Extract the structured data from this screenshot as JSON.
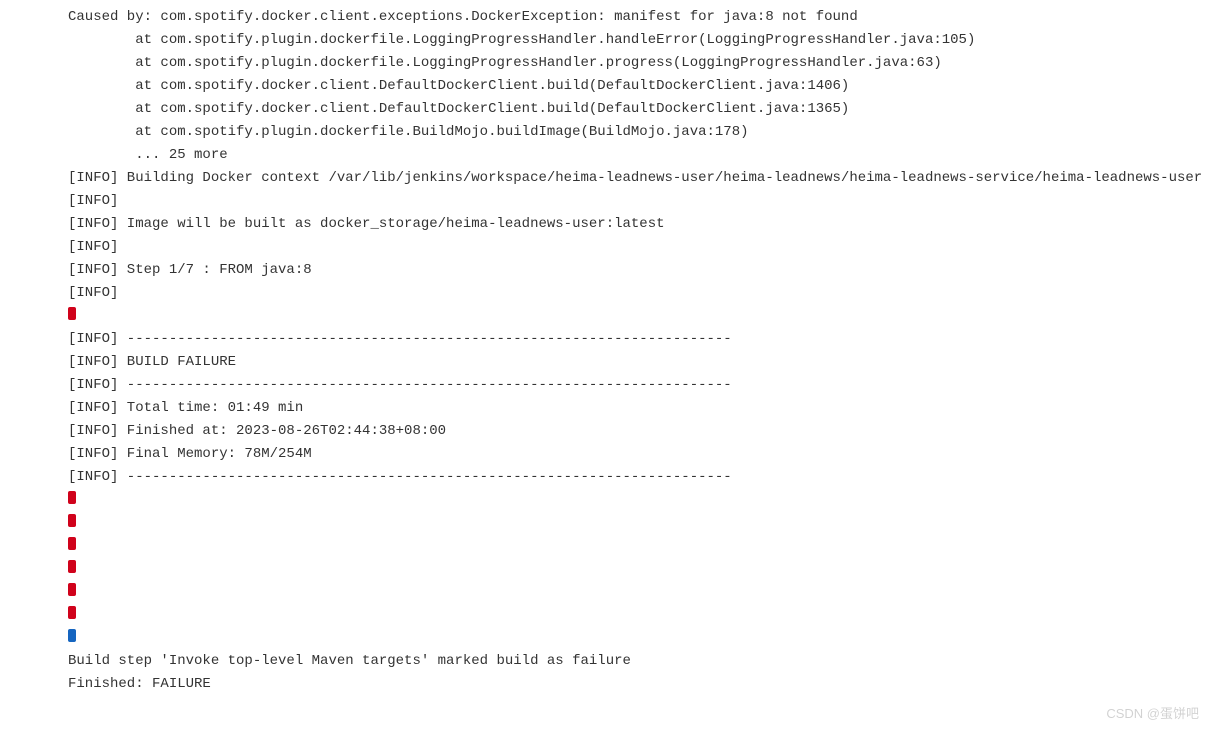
{
  "console": {
    "lines": [
      "Caused by: com.spotify.docker.client.exceptions.DockerException: manifest for java:8 not found",
      "        at com.spotify.plugin.dockerfile.LoggingProgressHandler.handleError(LoggingProgressHandler.java:105)",
      "        at com.spotify.plugin.dockerfile.LoggingProgressHandler.progress(LoggingProgressHandler.java:63)",
      "        at com.spotify.docker.client.DefaultDockerClient.build(DefaultDockerClient.java:1406)",
      "        at com.spotify.docker.client.DefaultDockerClient.build(DefaultDockerClient.java:1365)",
      "        at com.spotify.plugin.dockerfile.BuildMojo.buildImage(BuildMojo.java:178)",
      "        ... 25 more",
      "[INFO] Building Docker context /var/lib/jenkins/workspace/heima-leadnews-user/heima-leadnews/heima-leadnews-service/heima-leadnews-user",
      "[INFO] ",
      "[INFO] Image will be built as docker_storage/heima-leadnews-user:latest",
      "[INFO] ",
      "[INFO] Step 1/7 : FROM java:8",
      "[INFO] ",
      "@@RED@@",
      "[INFO] ------------------------------------------------------------------------",
      "[INFO] BUILD FAILURE",
      "[INFO] ------------------------------------------------------------------------",
      "[INFO] Total time: 01:49 min",
      "[INFO] Finished at: 2023-08-26T02:44:38+08:00",
      "[INFO] Final Memory: 78M/254M",
      "[INFO] ------------------------------------------------------------------------",
      "@@RED@@",
      "@@RED@@",
      "@@RED@@",
      "@@RED@@",
      "@@RED@@",
      "@@RED@@",
      "@@BLUE@@",
      "Build step 'Invoke top-level Maven targets' marked build as failure",
      "Finished: FAILURE"
    ]
  },
  "watermark": "CSDN @蛋饼吧"
}
